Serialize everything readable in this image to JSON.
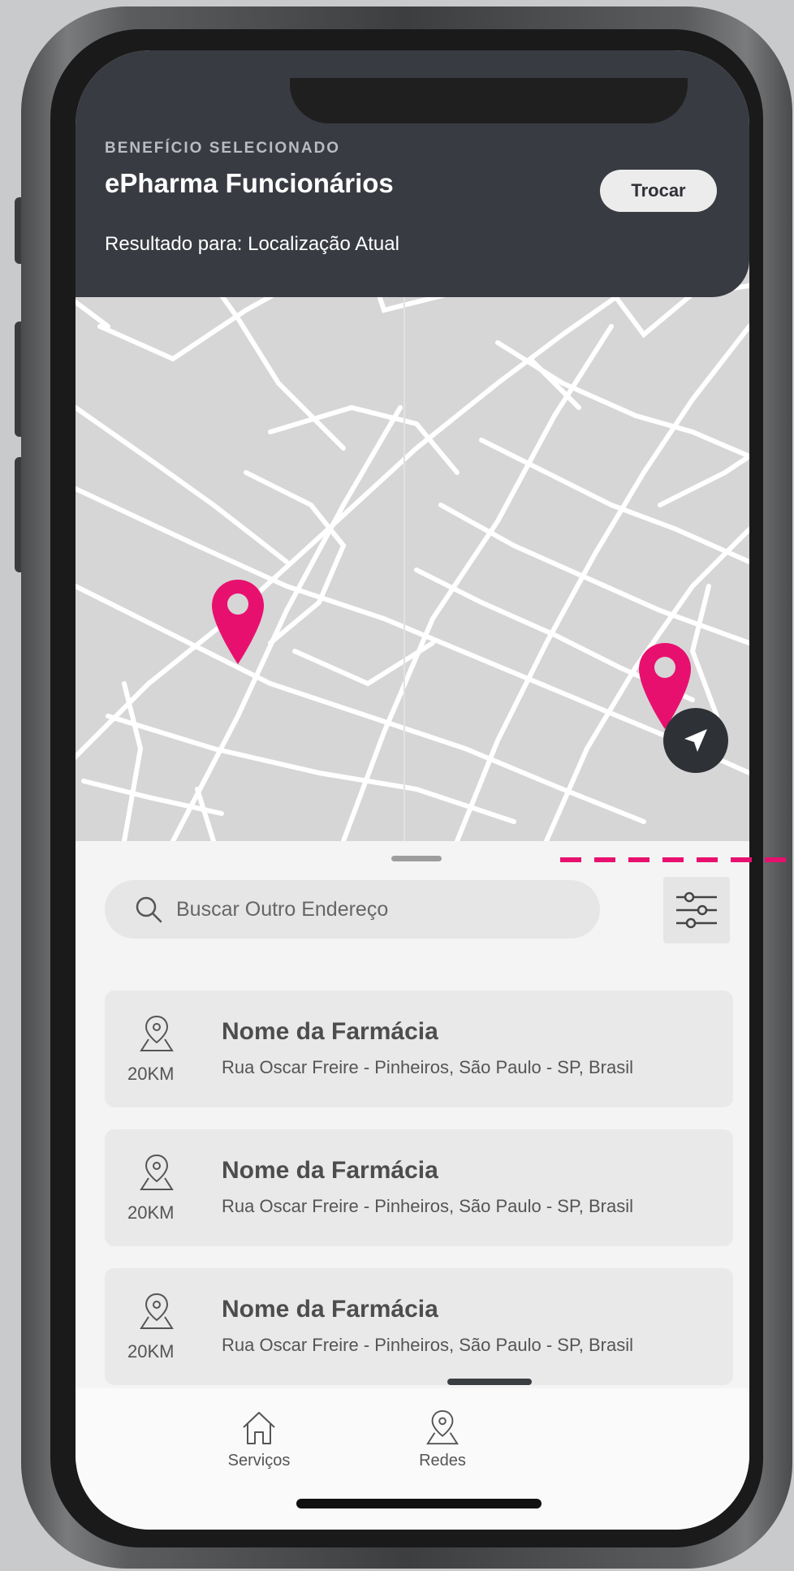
{
  "header": {
    "label": "BENEFÍCIO SELECIONADO",
    "title": "ePharma Funcionários",
    "result": "Resultado para: Localização Atual",
    "change_button": "Trocar"
  },
  "search": {
    "placeholder": "Buscar Outro Endereço"
  },
  "pharmacies": [
    {
      "name": "Nome da Farmácia",
      "address": "Rua  Oscar Freire - Pinheiros, São Paulo - SP, Brasil",
      "distance": "20KM"
    },
    {
      "name": "Nome da Farmácia",
      "address": "Rua  Oscar Freire - Pinheiros, São Paulo - SP, Brasil",
      "distance": "20KM"
    },
    {
      "name": "Nome da Farmácia",
      "address": "Rua  Oscar Freire - Pinheiros, São Paulo - SP, Brasil",
      "distance": "20KM"
    }
  ],
  "tabs": [
    {
      "label": "Serviços",
      "icon": "home-icon"
    },
    {
      "label": "Redes",
      "icon": "map-pin-icon"
    }
  ],
  "colors": {
    "header_bg": "#383b41",
    "map_bg": "#d6d6d6",
    "pin": "#e8106e",
    "annotation": "#e8106e"
  }
}
